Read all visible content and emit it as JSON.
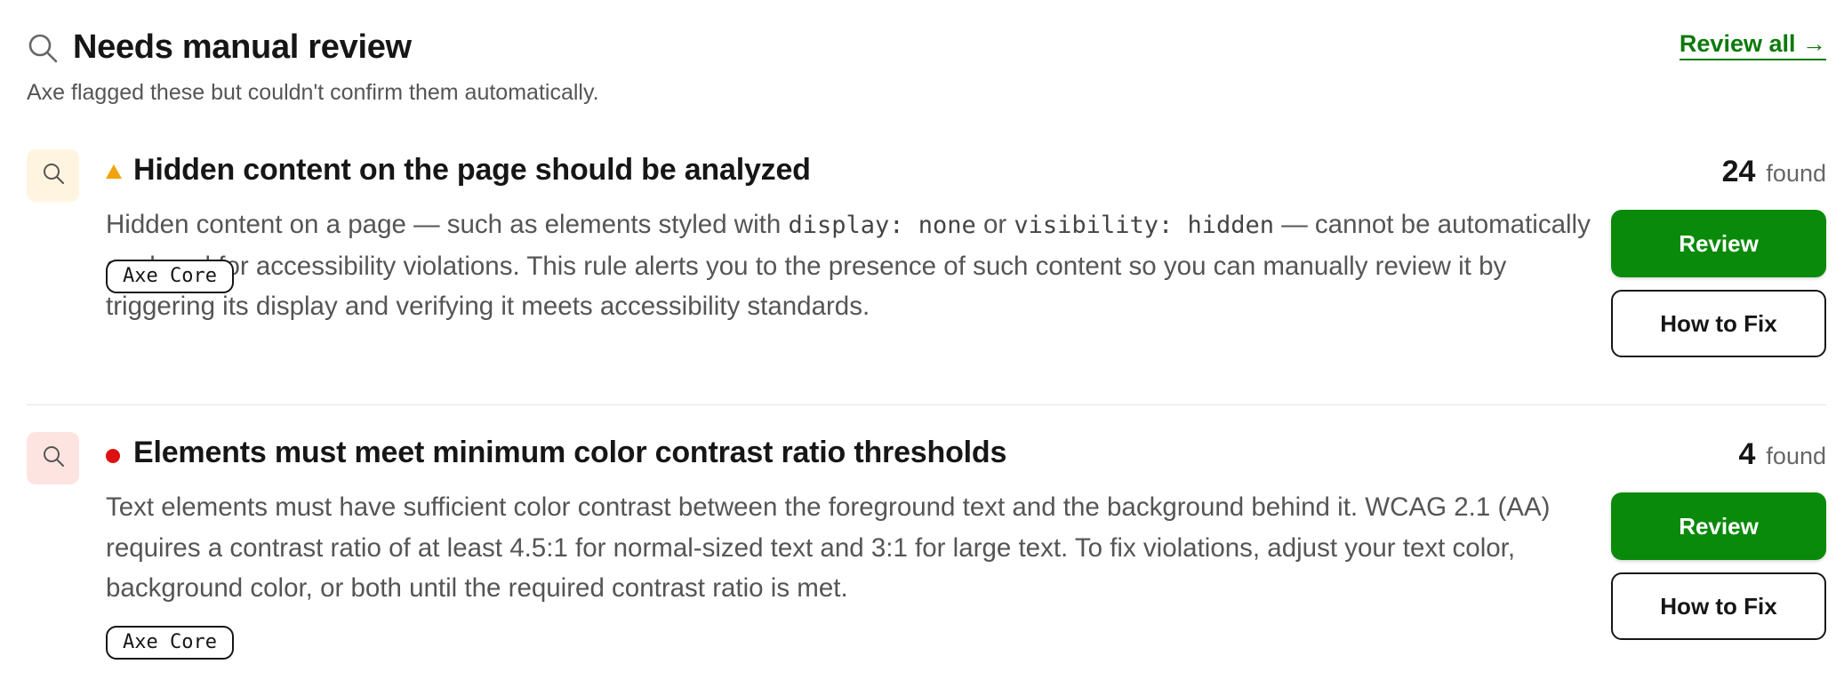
{
  "header": {
    "title": "Needs manual review",
    "subtitle": "Axe flagged these but couldn't confirm them automatically.",
    "review_all_label": "Review all →",
    "icon": "search-icon"
  },
  "colors": {
    "accent_green": "#0a8a0a",
    "warning_amber": "#f0a30a",
    "critical_red": "#dd1111"
  },
  "items": [
    {
      "title": "Hidden content on the page should be analyzed",
      "severity": "warning-triangle-icon",
      "description": {
        "part1": "Hidden content on a page — such as elements styled with ",
        "code1": "display: none",
        "part2": " or ",
        "code2": "visibility: hidden",
        "part3": " — cannot be automatically analyzed for accessibility violations. This rule alerts you to the presence of such content so you can manually review it by triggering its display and verifying it meets accessibility standards."
      },
      "tag": "Axe Core",
      "count": "24",
      "count_label": "found",
      "review_label": "Review",
      "fix_label": "How to Fix"
    },
    {
      "title": "Elements must meet minimum color contrast ratio thresholds",
      "severity": "critical-dot-icon",
      "description": {
        "part1": "Text elements must have sufficient color contrast between the foreground text and the background behind it. WCAG 2.1 (AA) requires a contrast ratio of at least 4.5:1 for normal-sized text and 3:1 for large text. To fix violations, adjust your text color, background color, or both until the required contrast ratio is met."
      },
      "tag": "Axe Core",
      "count": "4",
      "count_label": "found",
      "review_label": "Review",
      "fix_label": "How to Fix"
    }
  ]
}
